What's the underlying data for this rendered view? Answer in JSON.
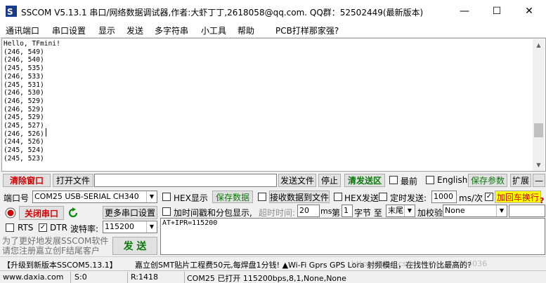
{
  "window": {
    "title": "SSCOM V5.13.1 串口/网络数据调试器,作者:大虾丁丁,2618058@qq.com. QQ群：52502449(最新版本)"
  },
  "menu": [
    "通讯端口",
    "串口设置",
    "显示",
    "发送",
    "多字符串",
    "小工具",
    "帮助",
    "PCB打样那家强?"
  ],
  "receive": {
    "lines": [
      "Hello, TFmini!",
      "(246, 549)",
      "(246, 540)",
      "(245, 535)",
      "(246, 533)",
      "(245, 531)",
      "(246, 530)",
      "(246, 529)",
      "(246, 529)",
      "(245, 529)",
      "(245, 527)",
      "(246, 526)",
      "(244, 526)",
      "(245, 524)",
      "(245, 523)"
    ]
  },
  "toolbar": {
    "clear": "清除窗口",
    "open_file": "打开文件",
    "file_path": "",
    "send_file": "发送文件",
    "stop": "停止",
    "clear_send": "清发送区",
    "front_label": "最前",
    "english_label": "English",
    "save_params": "保存参数",
    "expand": "扩展",
    "collapse": "—"
  },
  "port": {
    "port_label": "端口号",
    "port_value": "COM25 USB-SERIAL CH340",
    "close_port": "关闭串口",
    "more_settings": "更多串口设置",
    "rts_label": "RTS",
    "dtr_label": "DTR",
    "baud_label": "波特率:",
    "baud_value": "115200",
    "promo": "为了更好地发展SSCOM软件\n请您注册嘉立创F结尾客户",
    "send": "发  送"
  },
  "options": {
    "hex_display": "HEX显示",
    "save_data": "保存数据",
    "recv_to_file": "接收数据到文件",
    "hex_send": "HEX发送",
    "timed_send": "定时发送:",
    "interval": "1000",
    "interval_unit": "ms/次",
    "add_crlf": "加回车换行",
    "timestamp": "加时间戳和分包显示,",
    "timeout_label": "超时时间:",
    "timeout_value": "20",
    "ms": "ms",
    "byte_prefix": "第",
    "byte_index": "1",
    "byte_mid": "字节 至",
    "byte_end": "末尾",
    "checksum_label": "加校验",
    "checksum_value": "None"
  },
  "send_text": "AT+IPR=115200",
  "ad": {
    "left": "【升级到新版本SSCOM5.13.1】",
    "right": "嘉立创SMT贴片工程费50元,每焊盘1分钱!  ▲Wi-Fi Gprs GPS Lora 射频模组，在找性价比最高的?"
  },
  "watermark": "https://blog.csdn.net/qq_37764036",
  "status": {
    "url": "www.daxia.com",
    "sent": "S:0",
    "received": "R:1418",
    "port_state": "COM25 已打开  115200bps,8,1,None,None"
  },
  "colors": {
    "red": "#d00000",
    "green": "#0a7a0a",
    "highlight": "#ffff00"
  }
}
